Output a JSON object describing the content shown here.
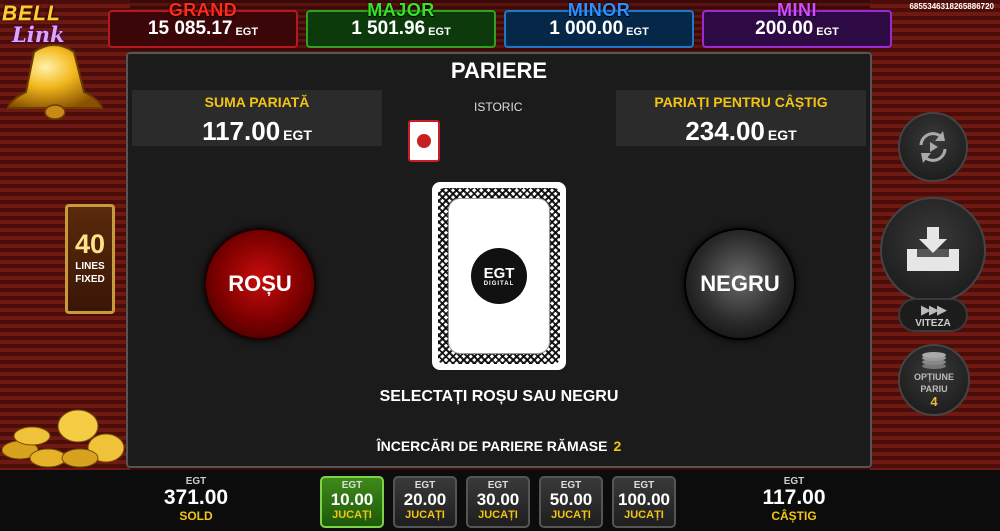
{
  "jackpots": {
    "grand": {
      "name": "GRAND",
      "value": "15 085.17",
      "currency": "EGT"
    },
    "major": {
      "name": "MAJOR",
      "value": "1 501.96",
      "currency": "EGT"
    },
    "minor": {
      "name": "MINOR",
      "value": "1 000.00",
      "currency": "EGT"
    },
    "mini": {
      "name": "MINI",
      "value": "200.00",
      "currency": "EGT"
    }
  },
  "game_id": "6855346318265886720",
  "logo": {
    "line1": "BELL",
    "line2": "Link"
  },
  "lines": {
    "count": "40",
    "label1": "LINES",
    "label2": "FIXED"
  },
  "gamble": {
    "title": "PARIERE",
    "bet_label": "SUMA PARIATĂ",
    "bet_value": "117.00",
    "bet_currency": "EGT",
    "history_label": "ISTORIC",
    "win_label": "PARIAȚI PENTRU CÂȘTIG",
    "win_value": "234.00",
    "win_currency": "EGT",
    "red_label": "ROȘU",
    "black_label": "NEGRU",
    "card_logo_main": "EGT",
    "card_logo_sub": "DIGITAL",
    "instruction": "SELECTAȚI ROȘU SAU NEGRU",
    "attempts_label": "ÎNCERCĂRI DE PARIERE RĂMASE",
    "attempts_count": "2"
  },
  "side": {
    "speed_label": "VITEZA",
    "speed_arrows": "▶▶▶",
    "bet_option_label1": "OPȚIUNE",
    "bet_option_label2": "PARIU",
    "bet_option_value": "4"
  },
  "bottom": {
    "balance": {
      "currency": "EGT",
      "value": "371.00",
      "label": "SOLD"
    },
    "win": {
      "currency": "EGT",
      "value": "117.00",
      "label": "CÂȘTIG"
    },
    "bets": [
      {
        "currency": "EGT",
        "value": "10.00",
        "label": "JUCAȚI",
        "active": true
      },
      {
        "currency": "EGT",
        "value": "20.00",
        "label": "JUCAȚI",
        "active": false
      },
      {
        "currency": "EGT",
        "value": "30.00",
        "label": "JUCAȚI",
        "active": false
      },
      {
        "currency": "EGT",
        "value": "50.00",
        "label": "JUCAȚI",
        "active": false
      },
      {
        "currency": "EGT",
        "value": "100.00",
        "label": "JUCAȚI",
        "active": false
      }
    ]
  },
  "colors": {
    "accent_yellow": "#f2c413",
    "red": "#c80c0c",
    "active_bet": "#3e8a1a"
  }
}
